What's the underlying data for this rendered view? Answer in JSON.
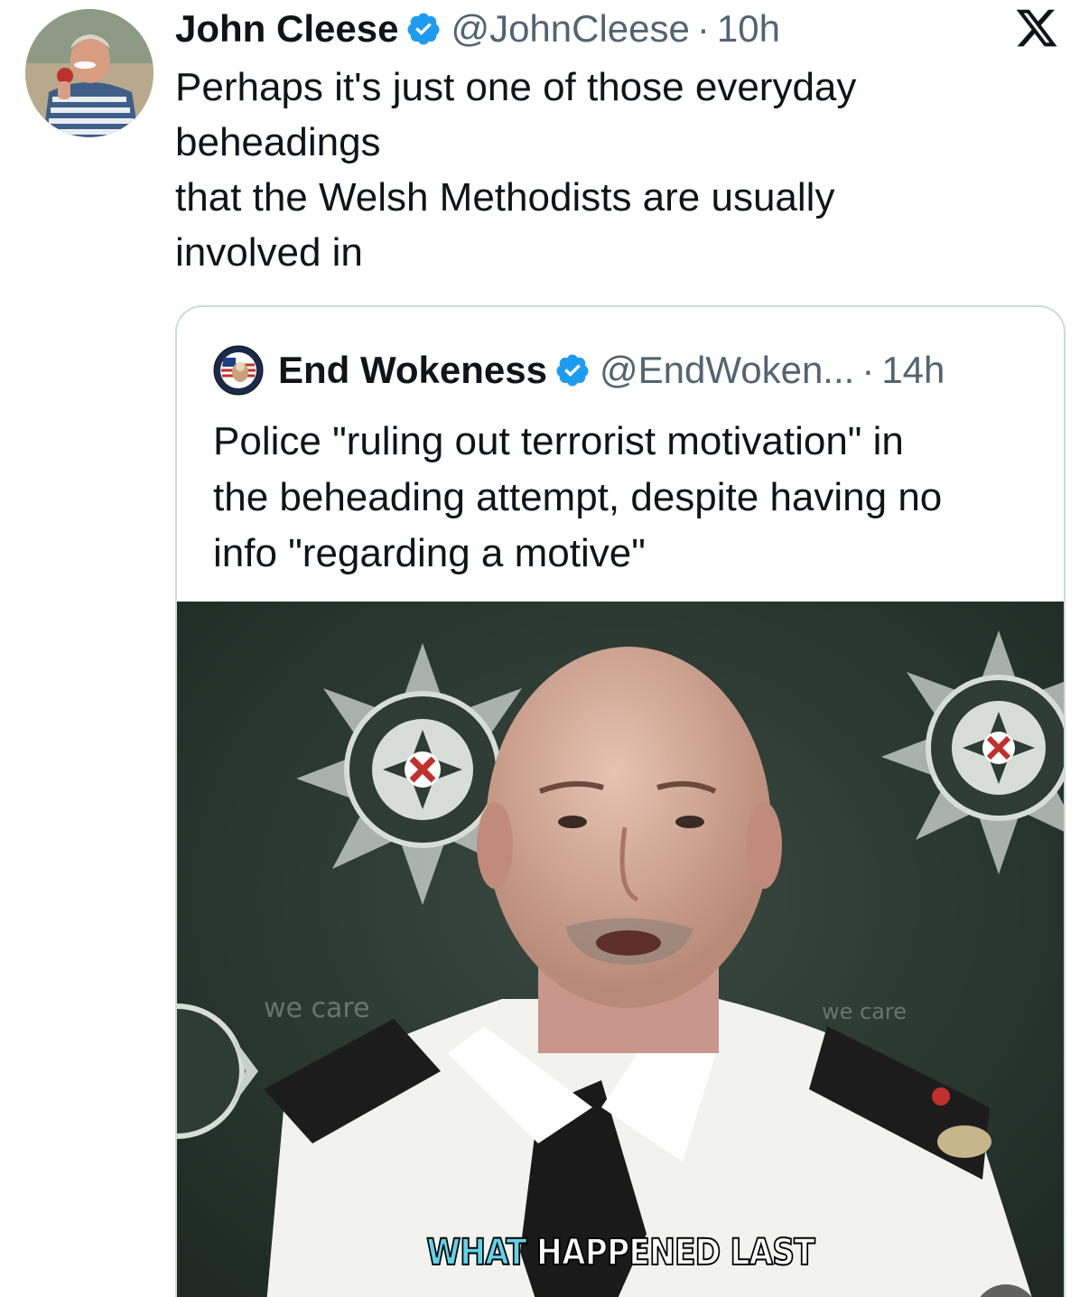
{
  "tweet": {
    "author_name": "John Cleese",
    "handle": "@JohnCleese",
    "separator": "·",
    "time": "10h",
    "text_lines": [
      "Perhaps it's just one of those everyday",
      "beheadings",
      "that the Welsh Methodists are usually",
      "involved in"
    ]
  },
  "quoted_tweet": {
    "author_name": "End Wokeness",
    "handle": "@EndWoken...",
    "separator": "·",
    "time": "14h",
    "text_lines": [
      "Police \"ruling out terrorist motivation\" in",
      "the beheading attempt, despite having no",
      "info \"regarding a motive\""
    ],
    "media": {
      "caption_word_1": "WHAT",
      "caption_rest": "HAPPENED LAST",
      "backdrop_text": "we care"
    }
  },
  "icons": [
    "x-logo-icon",
    "verified-badge-icon",
    "mute-icon"
  ],
  "colors": {
    "verified_blue": "#1d9bf0",
    "secondary_text": "#536471",
    "border": "#cfd9de",
    "caption_accent": "#5fd3ea"
  }
}
